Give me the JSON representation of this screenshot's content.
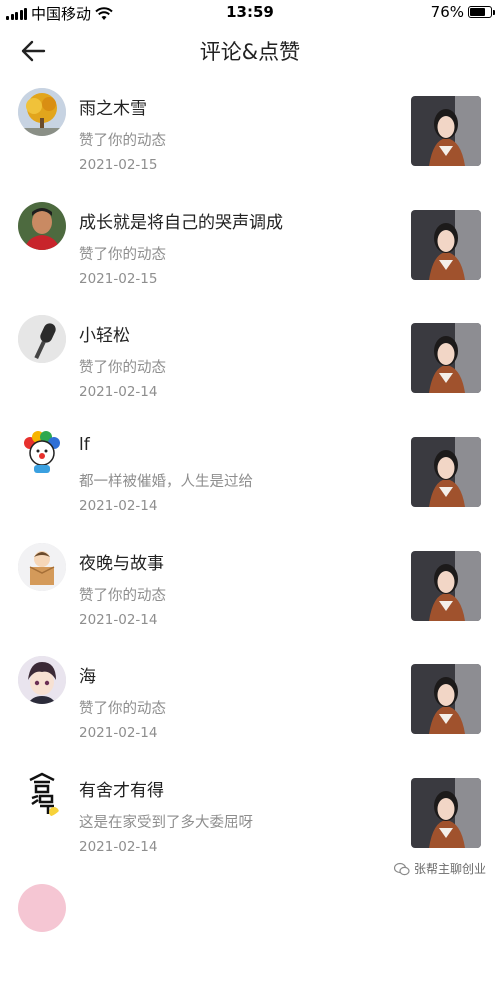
{
  "status_bar": {
    "carrier": "中国移动",
    "time": "13:59",
    "battery": "76%"
  },
  "nav": {
    "title": "评论&点赞"
  },
  "items": [
    {
      "name": "雨之木雪",
      "desc": "赞了你的动态",
      "date": "2021-02-15",
      "avatar_icon": "tree-avatar"
    },
    {
      "name": "成长就是将自己的哭声调成",
      "desc": "赞了你的动态",
      "date": "2021-02-15",
      "avatar_icon": "man-avatar"
    },
    {
      "name": "小轻松",
      "desc": "赞了你的动态",
      "date": "2021-02-14",
      "avatar_icon": "microphone-avatar"
    },
    {
      "name": "lf",
      "desc": "都一样被催婚，人生是过给",
      "date": "2021-02-14",
      "avatar_icon": "clown-avatar"
    },
    {
      "name": "夜晚与故事",
      "desc": "赞了你的动态",
      "date": "2021-02-14",
      "avatar_icon": "cartoon-box-avatar"
    },
    {
      "name": "海",
      "desc": "赞了你的动态",
      "date": "2021-02-14",
      "avatar_icon": "anime-boy-avatar"
    },
    {
      "name": "有舍才有得",
      "desc": "这是在家受到了多大委屈呀",
      "date": "2021-02-14",
      "avatar_icon": "calligraphy-avatar"
    }
  ],
  "watermark": "张帮主聊创业"
}
